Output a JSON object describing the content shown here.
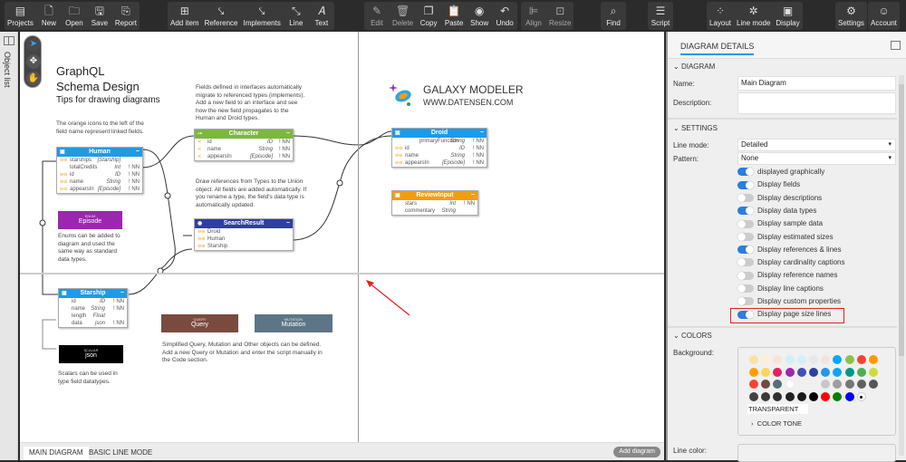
{
  "toolbar": {
    "groups": [
      [
        {
          "label": "Projects",
          "icon": "projects-icon"
        },
        {
          "label": "New",
          "icon": "new-file-icon"
        },
        {
          "label": "Open",
          "icon": "folder-open-icon"
        },
        {
          "label": "Save",
          "icon": "save-icon"
        },
        {
          "label": "Report",
          "icon": "report-icon"
        }
      ],
      [
        {
          "label": "Add item",
          "icon": "add-item-icon"
        },
        {
          "label": "Reference",
          "icon": "reference-icon"
        },
        {
          "label": "Implements",
          "icon": "implements-icon"
        },
        {
          "label": "Line",
          "icon": "line-icon"
        },
        {
          "label": "Text",
          "icon": "text-icon"
        }
      ],
      [
        {
          "label": "Edit",
          "icon": "edit-icon"
        },
        {
          "label": "Delete",
          "icon": "delete-icon"
        },
        {
          "label": "Copy",
          "icon": "copy-icon"
        },
        {
          "label": "Paste",
          "icon": "paste-icon"
        },
        {
          "label": "Show",
          "icon": "eye-icon"
        },
        {
          "label": "Undo",
          "icon": "undo-icon"
        }
      ],
      [
        {
          "label": "Align",
          "icon": "align-icon"
        },
        {
          "label": "Resize",
          "icon": "resize-icon"
        }
      ],
      [
        {
          "label": "Find",
          "icon": "search-icon"
        }
      ],
      [
        {
          "label": "Script",
          "icon": "script-icon"
        }
      ],
      [
        {
          "label": "Layout",
          "icon": "layout-icon"
        },
        {
          "label": "Line mode",
          "icon": "line-mode-icon"
        },
        {
          "label": "Display",
          "icon": "display-icon"
        }
      ],
      [
        {
          "label": "Settings",
          "icon": "gear-icon"
        }
      ],
      [
        {
          "label": "Account",
          "icon": "user-icon"
        }
      ]
    ]
  },
  "left_sidebar": {
    "label": "Object list"
  },
  "canvas": {
    "title_line1": "GraphQL",
    "title_line2": "Schema Design",
    "title_line3": "Tips for drawing diagrams",
    "notes": {
      "orange_icons": "The orange icons to the left of the field name represent linked fields.",
      "interfaces": "Fields defined in interfaces automatically migrate to referenced types (implements). Add a new field to an interface and see how the new field propagates to the Human and Droid types.",
      "union": "Draw references from Types to the Union object. All fields are added automatically. If you rename a type, the field's data type is automatically updated.",
      "enums": "Enums can be added to diagram and used the same way as standard data types.",
      "query": "Simplified Query, Mutation and Other objects can be defined. Add a new Query or Mutation and enter the script manually in the Code section.",
      "scalars": "Scalars can be used in type field datatypes."
    },
    "logo": {
      "title": "GALAXY MODELER",
      "url": "WWW.DATENSEN.COM"
    },
    "tables": {
      "human": {
        "name": "Human",
        "color": "#1e9be8",
        "rows": [
          {
            "name": "starships",
            "type": "[Starship]",
            "flag": "",
            "linked": true
          },
          {
            "name": "totalCredits",
            "type": "Int",
            "flag": "! NN",
            "linked": false
          },
          {
            "name": "id",
            "type": "ID",
            "flag": "! NN",
            "linked": true
          },
          {
            "name": "name",
            "type": "String",
            "flag": "! NN",
            "linked": true
          },
          {
            "name": "appearsIn",
            "type": "[Episode]",
            "flag": "! NN",
            "linked": true
          }
        ]
      },
      "character": {
        "name": "Character",
        "color": "#7cb83a",
        "rows": [
          {
            "name": "id",
            "type": "ID",
            "flag": "! NN"
          },
          {
            "name": "name",
            "type": "String",
            "flag": "! NN"
          },
          {
            "name": "appearsIn",
            "type": "[Episode]",
            "flag": "! NN"
          }
        ]
      },
      "search_result": {
        "name": "SearchResult",
        "color": "#2f3fa0",
        "rows": [
          {
            "name": "Droid"
          },
          {
            "name": "Human"
          },
          {
            "name": "Starship"
          }
        ]
      },
      "droid": {
        "name": "Droid",
        "color": "#1e9be8",
        "rows": [
          {
            "name": "primaryFunction",
            "type": "String",
            "flag": "! NN",
            "linked": false
          },
          {
            "name": "id",
            "type": "ID",
            "flag": "! NN",
            "linked": true
          },
          {
            "name": "name",
            "type": "String",
            "flag": "! NN",
            "linked": true
          },
          {
            "name": "appearsIn",
            "type": "[Episode]",
            "flag": "! NN",
            "linked": true
          }
        ]
      },
      "review_input": {
        "name": "ReviewInput",
        "color": "#f39c12",
        "rows": [
          {
            "name": "stars",
            "type": "Int",
            "flag": "! NN"
          },
          {
            "name": "commentary",
            "type": "String",
            "flag": ""
          }
        ]
      },
      "starship": {
        "name": "Starship",
        "color": "#1e9be8",
        "rows": [
          {
            "name": "id",
            "type": "ID",
            "flag": "! NN"
          },
          {
            "name": "name",
            "type": "String",
            "flag": "! NN"
          },
          {
            "name": "length",
            "type": "Float",
            "flag": ""
          },
          {
            "name": "data",
            "type": "json",
            "flag": "! NN"
          }
        ]
      }
    },
    "blocks": {
      "episode": {
        "kind": "ENUM",
        "name": "Episode",
        "color": "#9b27b0"
      },
      "json": {
        "kind": "SCALAR",
        "name": "json",
        "color": "#000000"
      },
      "query": {
        "kind": "QUERY",
        "name": "Query",
        "color": "#7b4a3f"
      },
      "mutation": {
        "kind": "MUTATION",
        "name": "Mutation",
        "color": "#5d7685"
      }
    },
    "annotation_color": "#e02020"
  },
  "bottom_tabs": {
    "tabs": [
      "MAIN DIAGRAM",
      "BASIC LINE MODE"
    ],
    "active": "MAIN DIAGRAM",
    "add_button": "Add diagram"
  },
  "panel": {
    "title": "DIAGRAM DETAILS",
    "diagram_section": "DIAGRAM",
    "name_label": "Name:",
    "name_value": "Main Diagram",
    "description_label": "Description:",
    "description_value": "",
    "settings_section": "SETTINGS",
    "line_mode_label": "Line mode:",
    "line_mode_value": "Detailed",
    "pattern_label": "Pattern:",
    "pattern_value": "None",
    "toggles": [
      {
        "label": "displayed graphically",
        "on": true
      },
      {
        "label": "Display fields",
        "on": true
      },
      {
        "label": "Display descriptions",
        "on": false
      },
      {
        "label": "Display data types",
        "on": true
      },
      {
        "label": "Display sample data",
        "on": false
      },
      {
        "label": "Display estimated sizes",
        "on": false
      },
      {
        "label": "Display references & lines",
        "on": true
      },
      {
        "label": "Display cardinality captions",
        "on": false
      },
      {
        "label": "Display reference names",
        "on": false
      },
      {
        "label": "Display line captions",
        "on": false
      },
      {
        "label": "Display custom properties",
        "on": false
      },
      {
        "label": "Display page size lines",
        "on": true
      }
    ],
    "colors_section": "COLORS",
    "background_label": "Background:",
    "palette": [
      [
        "#fde0a6",
        "#fdefd6",
        "#f6e3d6",
        "#d3eef6",
        "#d6eef6",
        "#e8e8e8",
        "#f4e3dc",
        "#03a9f4",
        "#8bc34a",
        "#f44336",
        "#ff9800"
      ],
      [
        "#ff9f00",
        "#fbd45a",
        "#e91e63",
        "#9c27b0",
        "#3f51b5",
        "#303f9f",
        "#2196f3",
        "#03a9f4",
        "#009688",
        "#4caf50",
        "#cddc39"
      ],
      [
        "#f44336",
        "#6d4c41",
        "#546e7a",
        "#ffffff",
        "",
        "",
        "#c8c8c8",
        "#9e9e9e",
        "#757575",
        "#616161",
        "#555555"
      ],
      [
        "#424242",
        "#3a3a3a",
        "#303030",
        "#222222",
        "#1a1a1a",
        "#000000",
        "#ff0000",
        "#008000",
        "#0000ff",
        "#ffffff"
      ]
    ],
    "transparent_label": "TRANSPARENT",
    "color_tone_label": "COLOR TONE",
    "line_color_label": "Line color:"
  }
}
